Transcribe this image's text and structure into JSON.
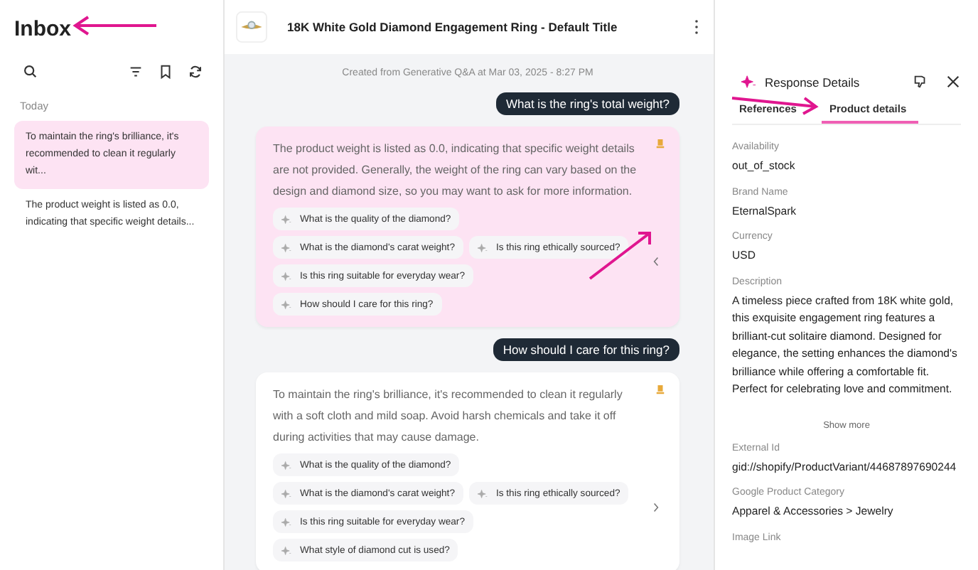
{
  "sidebar": {
    "title": "Inbox",
    "group_label": "Today",
    "items": [
      {
        "text": "To maintain the ring's brilliance, it's recommended to clean it regularly wit...",
        "selected": true
      },
      {
        "text": "The product weight is listed as 0.0, indicating that specific weight details...",
        "selected": false
      }
    ]
  },
  "header": {
    "title": "18K White Gold Diamond Engagement Ring - Default Title"
  },
  "chat": {
    "created": "Created from Generative Q&A at Mar 03, 2025 - 8:27 PM",
    "messages": [
      {
        "kind": "question",
        "text": "What is the ring's total weight?"
      },
      {
        "kind": "answer",
        "selected": true,
        "text": "The product weight is listed as 0.0, indicating that specific weight details are not provided. Generally, the weight of the ring can vary based on the design and diamond size, so you may want to ask for more information.",
        "suggestions": [
          [
            "What is the quality of the diamond?"
          ],
          [
            "What is the diamond's carat weight?",
            "Is this ring ethically sourced?"
          ],
          [
            "Is this ring suitable for everyday wear?"
          ],
          [
            "How should I care for this ring?"
          ]
        ]
      },
      {
        "kind": "question",
        "text": "How should I care for this ring?"
      },
      {
        "kind": "answer",
        "selected": false,
        "text": "To maintain the ring's brilliance, it's recommended to clean it regularly with a soft cloth and mild soap. Avoid harsh chemicals and take it off during activities that may cause damage.",
        "suggestions": [
          [
            "What is the quality of the diamond?"
          ],
          [
            "What is the diamond's carat weight?",
            "Is this ring ethically sourced?"
          ],
          [
            "Is this ring suitable for everyday wear?"
          ],
          [
            "What style of diamond cut is used?"
          ]
        ]
      }
    ]
  },
  "details": {
    "title": "Response Details",
    "tabs": [
      {
        "label": "References",
        "selected": false
      },
      {
        "label": "Product details",
        "selected": true
      }
    ],
    "fields": [
      {
        "label": "Availability",
        "value": "out_of_stock"
      },
      {
        "label": "Brand Name",
        "value": "EternalSpark"
      },
      {
        "label": "Currency",
        "value": "USD"
      },
      {
        "label": "Description",
        "value": "A timeless piece crafted from 18K white gold, this exquisite engagement ring features a brilliant-cut solitaire diamond. Designed for elegance, the setting enhances the diamond's brilliance while offering a comfortable fit. Perfect for celebrating love and commitment.",
        "more": "Show more"
      },
      {
        "label": "External Id",
        "value": "gid://shopify/ProductVariant/44687897690244"
      },
      {
        "label": "Google Product Category",
        "value": "Apparel & Accessories > Jewelry"
      },
      {
        "label": "Image Link"
      }
    ]
  }
}
